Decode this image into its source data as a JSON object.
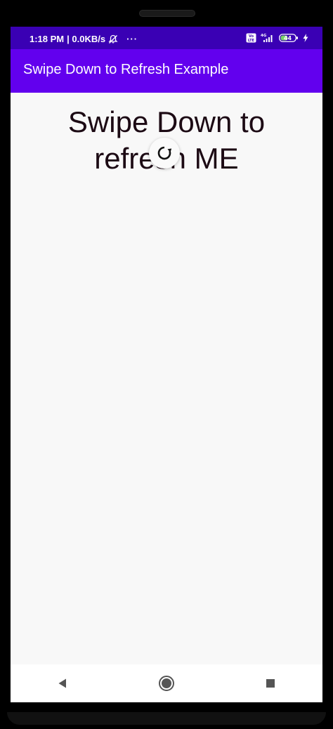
{
  "status_bar": {
    "time": "1:18 PM",
    "speed": "| 0.0KB/s",
    "more": "···",
    "network_label": "4G",
    "volte": "Vo LTE",
    "battery": "44"
  },
  "app_bar": {
    "title": "Swipe Down to Refresh Example"
  },
  "content": {
    "line1": "Swipe Down to",
    "line2": "refresh ME"
  },
  "colors": {
    "status_bar": "#3a00b4",
    "app_bar": "#6200ee",
    "background": "#f8f8f8"
  },
  "nav": {
    "back_icon": "back-triangle-icon",
    "home_icon": "home-circle-icon",
    "recents_icon": "recents-square-icon"
  }
}
